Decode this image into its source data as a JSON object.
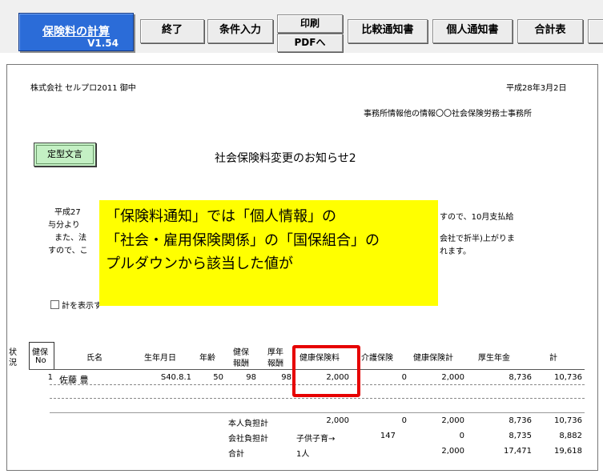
{
  "toolbar": {
    "title": "保険料の計算",
    "version": "V1.54",
    "buttons": {
      "end": "終了",
      "conditions": "条件入力",
      "print": "印刷",
      "pdf": "PDFへ",
      "compare": "比較通知書",
      "personal": "個人通知書",
      "total": "合計表"
    }
  },
  "doc": {
    "recipient": "株式会社 セルプロ2011 御中",
    "date": "平成28年3月2日",
    "sender": "事務所情報他の情報〇〇社会保険労務士事務所",
    "template_button": "定型文言",
    "heading": "社会保険料変更のお知らせ2",
    "body_left": [
      "平成27",
      "与分より",
      "また、法",
      "すので、こ"
    ],
    "body_right": [
      "すので、10月支払給",
      "会社で折半)上がりま",
      "れます。"
    ],
    "checkbox_label": "計を表示す"
  },
  "annotation": {
    "lines": [
      "「保険料通知」では「個人情報」の",
      "「社会・雇用保険関係」の「国保組合」の",
      "プルダウンから該当した値が"
    ]
  },
  "table": {
    "headers": {
      "status_a": "状",
      "status_b": "況",
      "kenpo_no_a": "健保",
      "kenpo_no_b": "No",
      "name": "氏名",
      "birth": "生年月日",
      "age": "年齢",
      "kenpo_a": "健保",
      "kenpo_b": "報酬",
      "kounen_a": "厚年",
      "kounen_b": "報酬",
      "health_fee": "健康保険料",
      "care_fee": "介護保険",
      "health_total": "健康保険計",
      "pension": "厚生年金",
      "total": "計"
    },
    "row": {
      "no": "1",
      "name": "佐藤 豊",
      "birth": "S40.8.1",
      "age": "50",
      "kenpo": "98",
      "kounen": "98",
      "health_fee": "2,000",
      "care_fee": "0",
      "health_total": "2,000",
      "pension": "8,736",
      "total": "10,736"
    },
    "summary": {
      "employee": {
        "label": "本人負担計",
        "health_fee": "2,000",
        "care_fee": "0",
        "health_total": "2,000",
        "pension": "8,736",
        "total": "10,736"
      },
      "company": {
        "label": "会社負担計",
        "kodomo": "子供子育→",
        "care_fee": "147",
        "health_total": "0",
        "pension": "8,735",
        "total": "8,882"
      },
      "grand": {
        "label": "合計",
        "persons": "1人",
        "health_total": "2,000",
        "pension": "17,471",
        "total": "19,618"
      }
    }
  },
  "colors": {
    "title_button": "#2b6cd8",
    "template_button": "#c4f0c4",
    "annotation_bg": "#ffff00",
    "highlight": "#e60000"
  }
}
